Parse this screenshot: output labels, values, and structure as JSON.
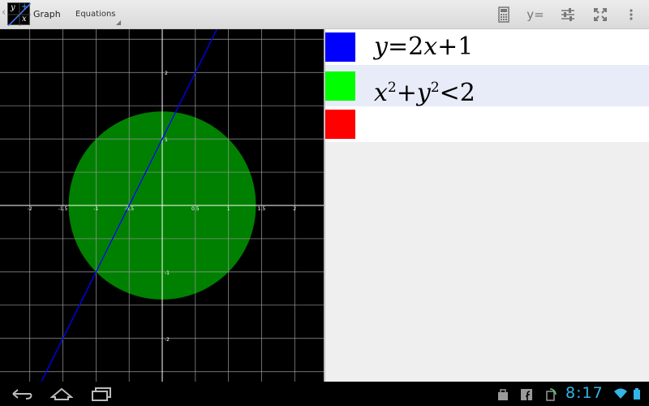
{
  "action_bar": {
    "app_title": "Graph",
    "spinner_label": "Equations",
    "app_icon": {
      "glyph_top_left": "y",
      "glyph_top_right": "+",
      "glyph_bottom_right": "x"
    },
    "buttons": [
      {
        "name": "calculator-icon",
        "label": ""
      },
      {
        "name": "y-equals-icon",
        "label": "y="
      },
      {
        "name": "settings-sliders-icon",
        "label": ""
      },
      {
        "name": "fullscreen-icon",
        "label": ""
      },
      {
        "name": "overflow-menu-icon",
        "label": ""
      }
    ]
  },
  "graph": {
    "x_range": [
      -2.45,
      2.45
    ],
    "y_range": [
      -2.65,
      2.65
    ],
    "grid_step": 0.5,
    "x_tick_labels": [
      "-2",
      "-1.5",
      "-1",
      "-0.5",
      "0.5",
      "1",
      "1.5",
      "2"
    ],
    "y_tick_labels": [
      "2",
      "1",
      "-1",
      "-2"
    ],
    "line": {
      "slope": 2,
      "intercept": 1,
      "color": "#0000ff"
    },
    "region": {
      "type": "disk",
      "radius_squared": 2,
      "color": "#008000"
    }
  },
  "equations": [
    {
      "color": "#0000ff",
      "text_parts": {
        "a": "y",
        "b": "=2",
        "c": "x",
        "d": "+1"
      }
    },
    {
      "color": "#00ff00",
      "text_parts": {
        "a": "x",
        "b": "2",
        "c": "+",
        "d": "y",
        "e": "2",
        "f": "<2"
      }
    },
    {
      "color": "#ff0000"
    }
  ],
  "status_bar": {
    "time": "8:17",
    "accent_color": "#33b5e5"
  }
}
